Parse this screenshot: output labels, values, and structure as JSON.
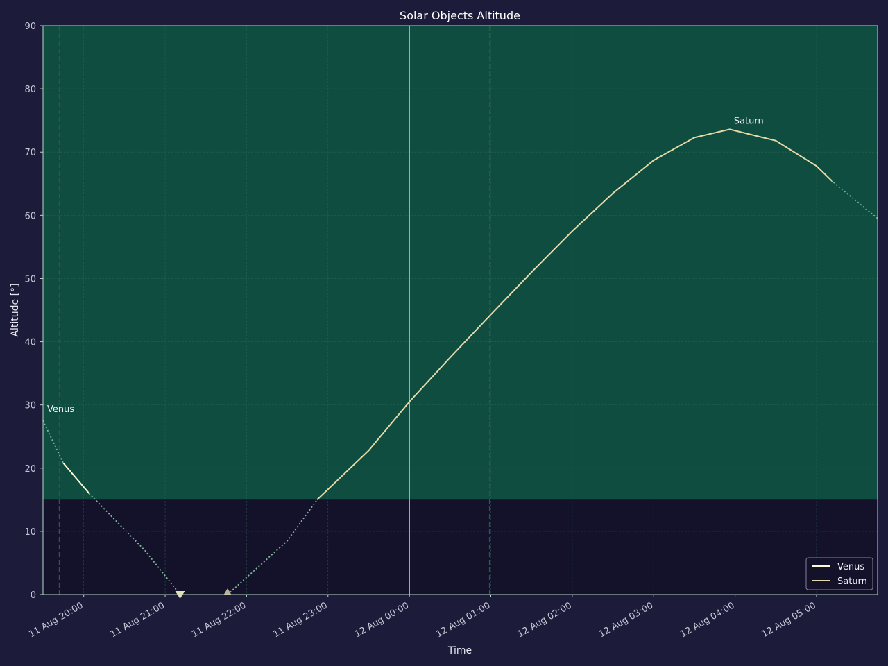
{
  "chart_data": {
    "type": "line",
    "title": "Solar Objects Altitude",
    "xlabel": "Time",
    "ylabel": "Altitude [°]",
    "xlim": [
      "2024-08-11T19:30",
      "2024-08-12T05:45"
    ],
    "ylim": [
      0,
      90
    ],
    "y_ticks": [
      0,
      10,
      20,
      30,
      40,
      50,
      60,
      70,
      80,
      90
    ],
    "x_ticks": [
      {
        "t": "2024-08-11T20:00",
        "label": "11 Aug 20:00"
      },
      {
        "t": "2024-08-11T21:00",
        "label": "11 Aug 21:00"
      },
      {
        "t": "2024-08-11T22:00",
        "label": "11 Aug 22:00"
      },
      {
        "t": "2024-08-11T23:00",
        "label": "11 Aug 23:00"
      },
      {
        "t": "2024-08-12T00:00",
        "label": "12 Aug 00:00"
      },
      {
        "t": "2024-08-12T01:00",
        "label": "12 Aug 01:00"
      },
      {
        "t": "2024-08-12T02:00",
        "label": "12 Aug 02:00"
      },
      {
        "t": "2024-08-12T03:00",
        "label": "12 Aug 03:00"
      },
      {
        "t": "2024-08-12T04:00",
        "label": "12 Aug 04:00"
      },
      {
        "t": "2024-08-12T05:00",
        "label": "12 Aug 05:00"
      }
    ],
    "grid": true,
    "legend_position": "bottom-right",
    "altitude_limit": 15,
    "midnight": "2024-08-12T00:00",
    "twilight_lines": [
      "2024-08-11T19:42",
      "2024-08-12T00:59"
    ],
    "series": [
      {
        "name": "Venus",
        "color": "#fdfbd4",
        "peak_label": "Venus",
        "peak_label_at": {
          "t": "2024-08-11T19:30",
          "y": 28.0
        },
        "points": [
          {
            "t": "2024-08-11T19:30",
            "y": 27.5
          },
          {
            "t": "2024-08-11T19:45",
            "y": 20.8
          },
          {
            "t": "2024-08-11T20:04",
            "y": 16.0
          },
          {
            "t": "2024-08-11T20:45",
            "y": 7.0
          },
          {
            "t": "2024-08-11T21:11",
            "y": 0.0
          }
        ],
        "solid_range": [
          "2024-08-11T19:45",
          "2024-08-11T20:04"
        ],
        "set_marker": {
          "t": "2024-08-11T21:11",
          "y": 0
        }
      },
      {
        "name": "Saturn",
        "color": "#e8d9a8",
        "peak_label": "Saturn",
        "peak_label_at": {
          "t": "2024-08-12T03:56",
          "y": 73.6
        },
        "points": [
          {
            "t": "2024-08-11T21:46",
            "y": 0.0
          },
          {
            "t": "2024-08-11T22:30",
            "y": 8.5
          },
          {
            "t": "2024-08-11T22:52",
            "y": 15.0
          },
          {
            "t": "2024-08-11T23:30",
            "y": 22.8
          },
          {
            "t": "2024-08-12T00:00",
            "y": 30.5
          },
          {
            "t": "2024-08-12T00:30",
            "y": 37.5
          },
          {
            "t": "2024-08-12T01:00",
            "y": 44.3
          },
          {
            "t": "2024-08-12T01:30",
            "y": 51.0
          },
          {
            "t": "2024-08-12T02:00",
            "y": 57.5
          },
          {
            "t": "2024-08-12T02:30",
            "y": 63.5
          },
          {
            "t": "2024-08-12T03:00",
            "y": 68.7
          },
          {
            "t": "2024-08-12T03:30",
            "y": 72.3
          },
          {
            "t": "2024-08-12T03:56",
            "y": 73.6
          },
          {
            "t": "2024-08-12T04:30",
            "y": 71.8
          },
          {
            "t": "2024-08-12T05:00",
            "y": 67.8
          },
          {
            "t": "2024-08-12T05:12",
            "y": 65.3
          },
          {
            "t": "2024-08-12T05:45",
            "y": 59.5
          }
        ],
        "solid_range": [
          "2024-08-11T22:52",
          "2024-08-12T05:12"
        ],
        "rise_marker": {
          "t": "2024-08-11T21:46",
          "y": 0
        }
      }
    ]
  },
  "colors": {
    "background": "#1d1b3a",
    "observable_zone": "#0f4d40",
    "below_limit_zone": "#14122b",
    "grid": "#2e6b55",
    "frame": "#b8d8c8",
    "midnight_line": "#a7bfb3",
    "twilight_line": "#4a4a4a",
    "dotted_line": "#7fb89a"
  }
}
